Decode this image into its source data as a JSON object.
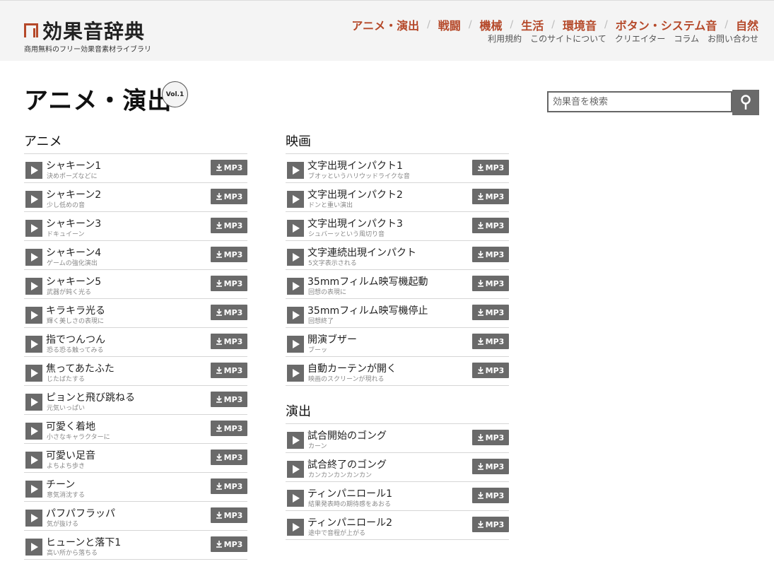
{
  "site": {
    "logo_text": "効果音辞典",
    "tagline": "商用無料のフリー効果音素材ライブラリ",
    "accent_color": "#b5492a"
  },
  "nav_main": [
    "アニメ・演出",
    "戦闘",
    "機械",
    "生活",
    "環境音",
    "ボタン・システム音",
    "自然"
  ],
  "nav_sub": [
    "利用規約",
    "このサイトについて",
    "クリエイター",
    "コラム",
    "お問い合わせ"
  ],
  "page": {
    "title": "アニメ・演出",
    "volume": "Vol.1"
  },
  "search": {
    "placeholder": "効果音を検索",
    "icon": "search-icon"
  },
  "download_label": "MP3",
  "categories_left": [
    {
      "title": "アニメ",
      "items": [
        {
          "name": "シャキーン1",
          "desc": "決めポーズなどに"
        },
        {
          "name": "シャキーン2",
          "desc": "少し低めの音"
        },
        {
          "name": "シャキーン3",
          "desc": "ドキュイーン"
        },
        {
          "name": "シャキーン4",
          "desc": "ゲームの強化演出"
        },
        {
          "name": "シャキーン5",
          "desc": "武器が鈍く光る"
        },
        {
          "name": "キラキラ光る",
          "desc": "輝く美しさの表現に"
        },
        {
          "name": "指でつんつん",
          "desc": "恐る恐る触ってみる"
        },
        {
          "name": "焦ってあたふた",
          "desc": "じたばたする"
        },
        {
          "name": "ピョンと飛び跳ねる",
          "desc": "元気いっぱい"
        },
        {
          "name": "可愛く着地",
          "desc": "小さなキャラクターに"
        },
        {
          "name": "可愛い足音",
          "desc": "よちよち歩き"
        },
        {
          "name": "チーン",
          "desc": "意気消沈する"
        },
        {
          "name": "パフパフラッパ",
          "desc": "気が抜ける"
        },
        {
          "name": "ヒューンと落下1",
          "desc": "高い所から落ちる"
        }
      ]
    }
  ],
  "categories_right": [
    {
      "title": "映画",
      "items": [
        {
          "name": "文字出現インパクト1",
          "desc": "ブオッというハリウッドライクな音"
        },
        {
          "name": "文字出現インパクト2",
          "desc": "ドンと重い演出"
        },
        {
          "name": "文字出現インパクト3",
          "desc": "シュバーッという風切り音"
        },
        {
          "name": "文字連続出現インパクト",
          "desc": "5文字表示される"
        },
        {
          "name": "35mmフィルム映写機起動",
          "desc": "回想の表現に"
        },
        {
          "name": "35mmフィルム映写機停止",
          "desc": "回想終了"
        },
        {
          "name": "開演ブザー",
          "desc": "ブーッ"
        },
        {
          "name": "自動カーテンが開く",
          "desc": "映画のスクリーンが現れる"
        }
      ]
    },
    {
      "title": "演出",
      "items": [
        {
          "name": "試合開始のゴング",
          "desc": "カーン"
        },
        {
          "name": "試合終了のゴング",
          "desc": "カンカンカンカンカン"
        },
        {
          "name": "ティンパニロール1",
          "desc": "結果発表時の期待感をあおる"
        },
        {
          "name": "ティンパニロール2",
          "desc": "途中で音程が上がる"
        }
      ]
    }
  ]
}
